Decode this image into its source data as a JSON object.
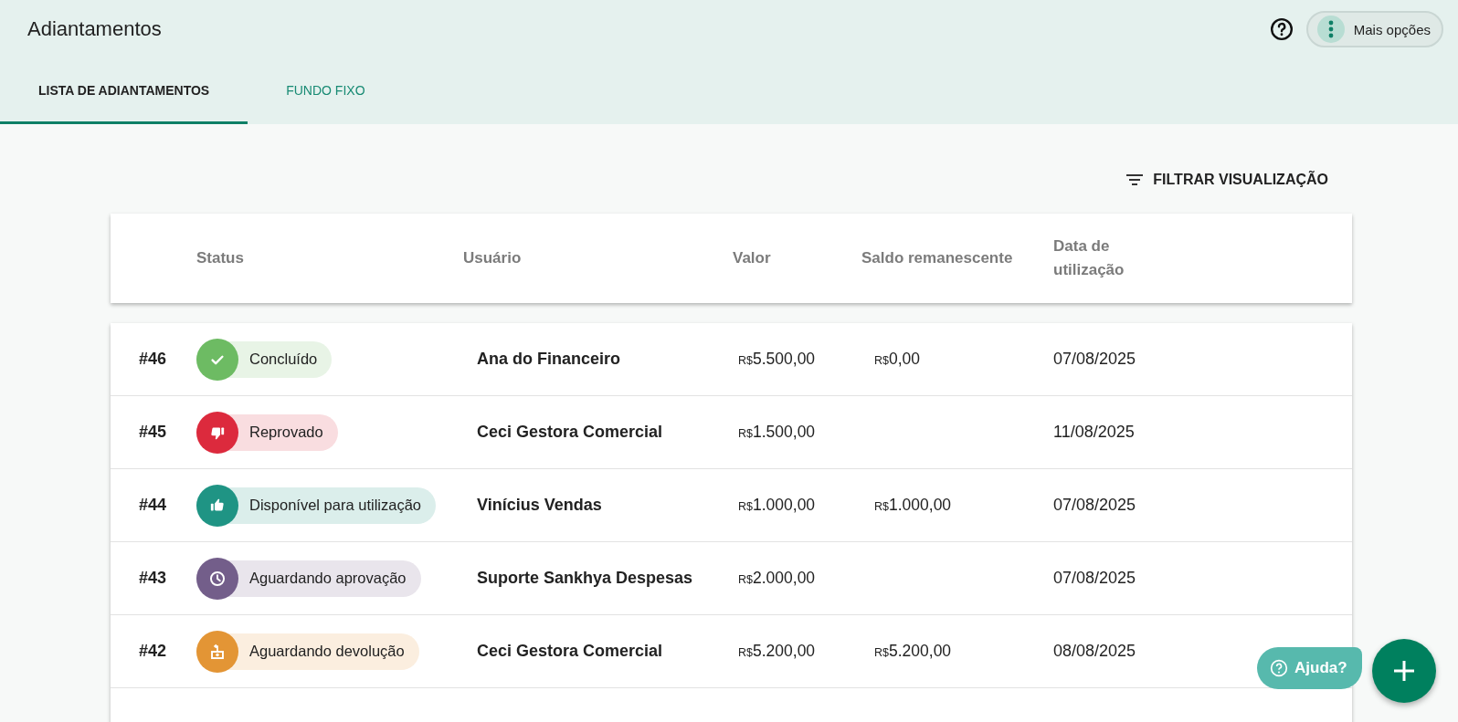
{
  "header": {
    "title": "Adiantamentos",
    "more_options": "Mais opções"
  },
  "tabs": [
    {
      "label": "LISTA DE ADIANTAMENTOS",
      "selected": true
    },
    {
      "label": "FUNDO FIXO",
      "selected": false
    }
  ],
  "filter": {
    "label": "FILTRAR VISUALIZAÇÃO"
  },
  "table": {
    "columns": [
      "Status",
      "Usuário",
      "Valor",
      "Saldo remanescente",
      "Data de utilização"
    ],
    "rows": [
      {
        "id": "#46",
        "status": {
          "label": "Concluído",
          "kind": "done",
          "color": "#6dbb63"
        },
        "user": "Ana do Financeiro",
        "value": {
          "currency": "R$",
          "amount": "5.500,00"
        },
        "balance": {
          "currency": "R$",
          "amount": "0,00"
        },
        "date": "07/08/2025"
      },
      {
        "id": "#45",
        "status": {
          "label": "Reprovado",
          "kind": "rejected",
          "color": "#dc2a3d"
        },
        "user": "Ceci Gestora Comercial",
        "value": {
          "currency": "R$",
          "amount": "1.500,00"
        },
        "date": "11/08/2025"
      },
      {
        "id": "#44",
        "status": {
          "label": "Disponível para utilização",
          "kind": "available",
          "color": "#1f9484"
        },
        "user": "Vinícius Vendas",
        "value": {
          "currency": "R$",
          "amount": "1.000,00"
        },
        "balance": {
          "currency": "R$",
          "amount": "1.000,00"
        },
        "date": "07/08/2025"
      },
      {
        "id": "#43",
        "status": {
          "label": "Aguardando aprovação",
          "kind": "pending",
          "color": "#735e8a"
        },
        "user": "Suporte Sankhya Despesas",
        "value": {
          "currency": "R$",
          "amount": "2.000,00"
        },
        "date": "07/08/2025"
      },
      {
        "id": "#42",
        "status": {
          "label": "Aguardando devolução",
          "kind": "return",
          "color": "#e39535"
        },
        "user": "Ceci Gestora Comercial",
        "value": {
          "currency": "R$",
          "amount": "5.200,00"
        },
        "balance": {
          "currency": "R$",
          "amount": "5.200,00"
        },
        "date": "08/08/2025"
      }
    ]
  },
  "help_button": {
    "label": "Ajuda?"
  }
}
